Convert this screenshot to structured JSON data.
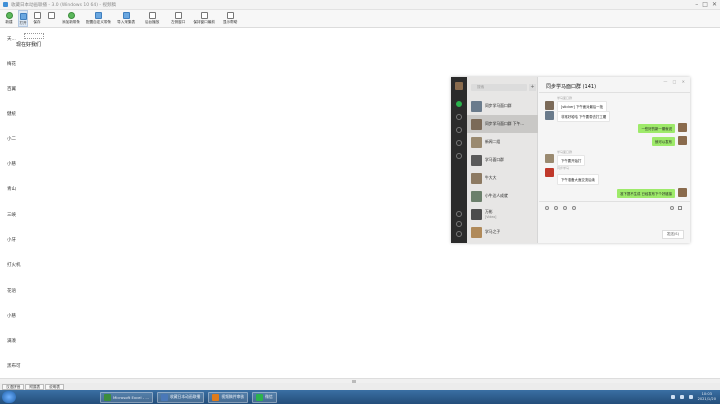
{
  "window": {
    "title": "收藏日本动画联播 - 3.0 (Windows 10 64) - 视频稿"
  },
  "toolbar": {
    "buttons": [
      {
        "label": "新建",
        "icon": "new-icon"
      },
      {
        "label": "打开",
        "icon": "open-icon"
      },
      {
        "label": "保存",
        "icon": "save-icon"
      },
      {
        "label": "",
        "icon": "print-icon"
      },
      {
        "label": "添加新带条",
        "icon": "add-strip-icon"
      },
      {
        "label": "配置自定义带条",
        "icon": "config-strip-icon"
      },
      {
        "label": "导入采集表",
        "icon": "import-icon"
      },
      {
        "label": "后台播放",
        "icon": "bg-play-icon"
      },
      {
        "label": "左侧窗口",
        "icon": "left-window-icon"
      },
      {
        "label": "保持窗口最前",
        "icon": "pin-window-icon"
      },
      {
        "label": "显示帮助",
        "icon": "help-icon"
      }
    ]
  },
  "sheet": {
    "selected_text": "现在好我们",
    "rows": [
      "天...",
      "梅花",
      "百翼",
      "健统",
      "小二",
      "小慈",
      "青山",
      "三峡",
      "小牙",
      "打火机",
      "花语",
      "小慈",
      "满凑",
      "黑布可"
    ]
  },
  "sheet_tabs": [
    "汉语拼音",
    "附属表",
    "说明表"
  ],
  "wechat": {
    "search_placeholder": "搜索",
    "group_name": "同步学马面口群 (141)",
    "window_controls": "— □ ✕",
    "conversations": [
      {
        "name": "同步学马面口群",
        "preview": ""
      },
      {
        "name": "同步学马面口群 下午...",
        "preview": ""
      },
      {
        "name": "新闻二组",
        "preview": ""
      },
      {
        "name": "学马面口群",
        "preview": ""
      },
      {
        "name": "牛大大",
        "preview": ""
      },
      {
        "name": "小牛达人成就",
        "preview": ""
      },
      {
        "name": "万彬",
        "preview": "[Video]"
      },
      {
        "name": "学马之子",
        "preview": ""
      }
    ],
    "messages": [
      {
        "side": "in",
        "sender": "学马面口群",
        "text": "[sticker] 下午面对最后一批"
      },
      {
        "side": "in",
        "sender": "",
        "text": "非常好哈哈 下午要带去打工喔"
      },
      {
        "side": "out",
        "sender": "",
        "text": "一些好的新一期就说"
      },
      {
        "side": "out",
        "sender": "",
        "text": "就可以发布"
      },
      {
        "side": "in",
        "sender": "学马面口群",
        "text": "下午要开始打"
      },
      {
        "side": "in",
        "sender": "同步学马",
        "text": "下午准备大面交流后续"
      },
      {
        "side": "out",
        "sender": "",
        "text": "准下提不生成 已经发布下个好链接"
      }
    ],
    "send_label": "发送(S)"
  },
  "taskbar": {
    "apps": [
      {
        "label": "Microsoft Excel - ...",
        "color": "#3c8d3c"
      },
      {
        "label": "收藏日本动画联播",
        "color": "#4a78b8"
      },
      {
        "label": "视频稿件审核",
        "color": "#e07b1a"
      },
      {
        "label": "微信",
        "color": "#2bb24c"
      }
    ],
    "clock_time": "10:03",
    "clock_date": "2021/1/20"
  }
}
